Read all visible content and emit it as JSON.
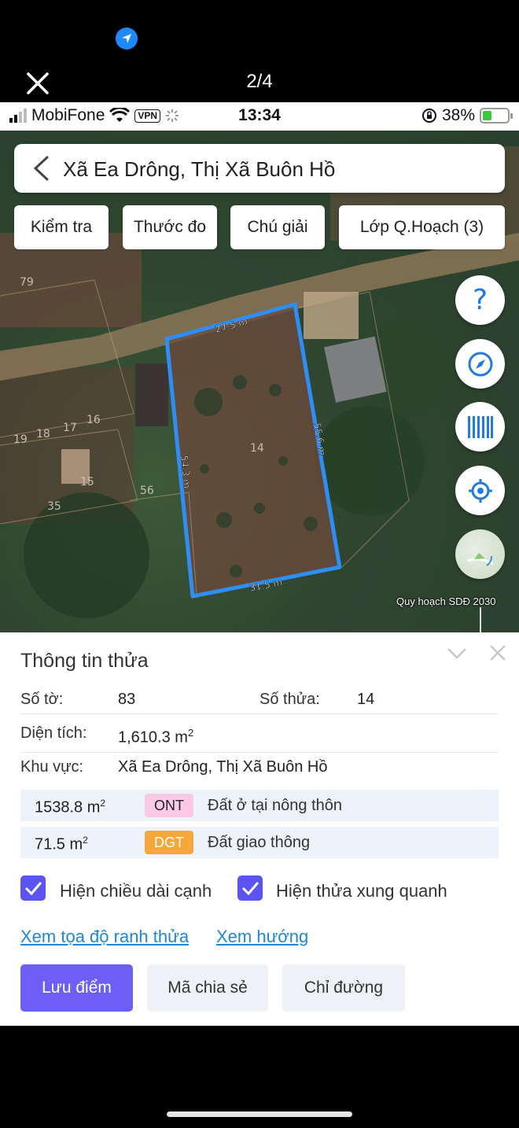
{
  "viewer": {
    "counter": "2/4"
  },
  "status_bar": {
    "carrier": "MobiFone",
    "vpn": "VPN",
    "time": "13:34",
    "battery": "38%",
    "battery_level": 0.38
  },
  "search": {
    "title": "Xã Ea Drông, Thị Xã Buôn Hồ"
  },
  "chips": [
    "Kiểm tra",
    "Thước đo",
    "Chú giải",
    "Lớp Q.Hoạch (3)"
  ],
  "map": {
    "edge_labels": {
      "top": "27.5 m",
      "right": "55.6 m",
      "left": "54.3 m",
      "bottom": "31.5 m"
    },
    "parcel_numbers": [
      "79",
      "14",
      "19",
      "18",
      "17",
      "15",
      "16",
      "35",
      "56"
    ],
    "caption": "Quy hoạch SDĐ 2030",
    "fab_icons": [
      "help-icon",
      "compass-icon",
      "barcode-icon",
      "locate-icon",
      "map-thumbnail"
    ],
    "fab_help_glyph": "?"
  },
  "panel": {
    "title": "Thông tin thửa",
    "so_to_label": "Số tờ:",
    "so_to_value": "83",
    "so_thua_label": "Số thửa:",
    "so_thua_value": "14",
    "dien_tich_label": "Diện tích:",
    "dien_tich_value": "1,610.3 m",
    "sq": "2",
    "khu_vuc_label": "Khu vực:",
    "khu_vuc_value": "Xã Ea Drông, Thị Xã Buôn Hồ",
    "land_uses": [
      {
        "area": "1538.8 m",
        "sq": "2",
        "code": "ONT",
        "desc": "Đất ở tại nông thôn",
        "color": "#f9c9e6"
      },
      {
        "area": "71.5 m",
        "sq": "2",
        "code": "DGT",
        "desc": "Đất giao thông",
        "color": "#f6a73a"
      }
    ],
    "check_edges": "Hiện chiều dài cạnh",
    "check_neighbors": "Hiện thửa xung quanh",
    "link_coords": "Xem tọa độ ranh thửa",
    "link_direction": "Xem hướng",
    "btn_save": "Lưu điểm",
    "btn_share": "Mã chia sẻ",
    "btn_route": "Chỉ đường"
  },
  "colors": {
    "accent": "#6b5ff5",
    "link": "#1f86d8",
    "parcel_outline": "#2f8ef5"
  }
}
